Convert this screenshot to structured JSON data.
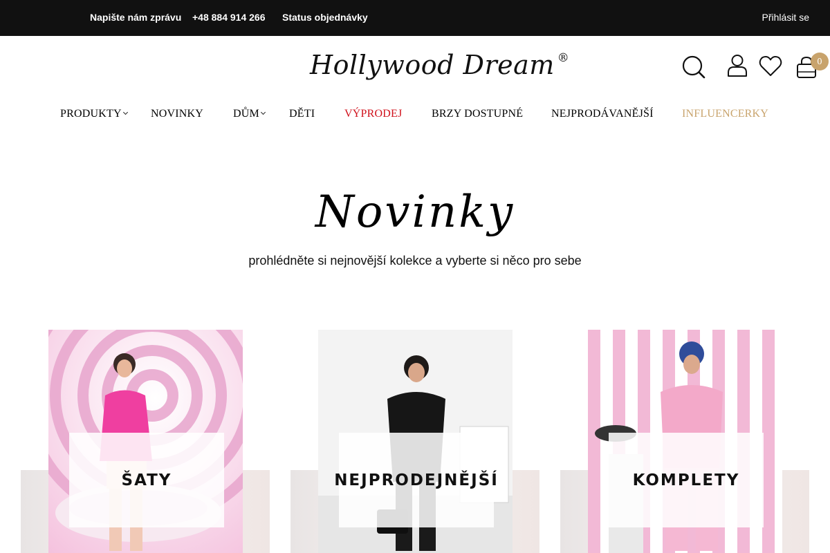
{
  "topbar": {
    "message_link": "Napište nám zprávu",
    "phone": "+48 884 914 266",
    "order_status": "Status objednávky",
    "login": "Přihlásit se"
  },
  "header": {
    "logo_text": "Hollywood Dream",
    "logo_mark": "®",
    "cart_count": "0",
    "icons": [
      "search-icon",
      "user-icon",
      "heart-icon",
      "cart-icon"
    ]
  },
  "nav": {
    "items": [
      {
        "label": "PRODUKTY",
        "has_dropdown": true
      },
      {
        "label": "NOVINKY",
        "has_dropdown": false
      },
      {
        "label": "DŮM",
        "has_dropdown": true
      },
      {
        "label": "DĚTI",
        "has_dropdown": false
      },
      {
        "label": "VÝPRODEJ",
        "has_dropdown": false,
        "color": "#d0101b"
      },
      {
        "label": "BRZY DOSTUPNÉ",
        "has_dropdown": false
      },
      {
        "label": "NEJPRODÁVANĚJŠÍ",
        "has_dropdown": false
      },
      {
        "label": "INFLUENCERKY",
        "has_dropdown": false,
        "color": "#c8a36c"
      }
    ]
  },
  "hero": {
    "title": "Novinky",
    "subtitle": "prohlédněte si nejnovější kolekce a vyberte si něco pro sebe"
  },
  "cards": [
    {
      "label": "ŠATY"
    },
    {
      "label": "NEJPRODEJNĚJŠÍ"
    },
    {
      "label": "KOMPLETY"
    }
  ],
  "colors": {
    "topbar_bg": "#111111",
    "accent_gold": "#c8a36c",
    "sale_red": "#d0101b"
  }
}
